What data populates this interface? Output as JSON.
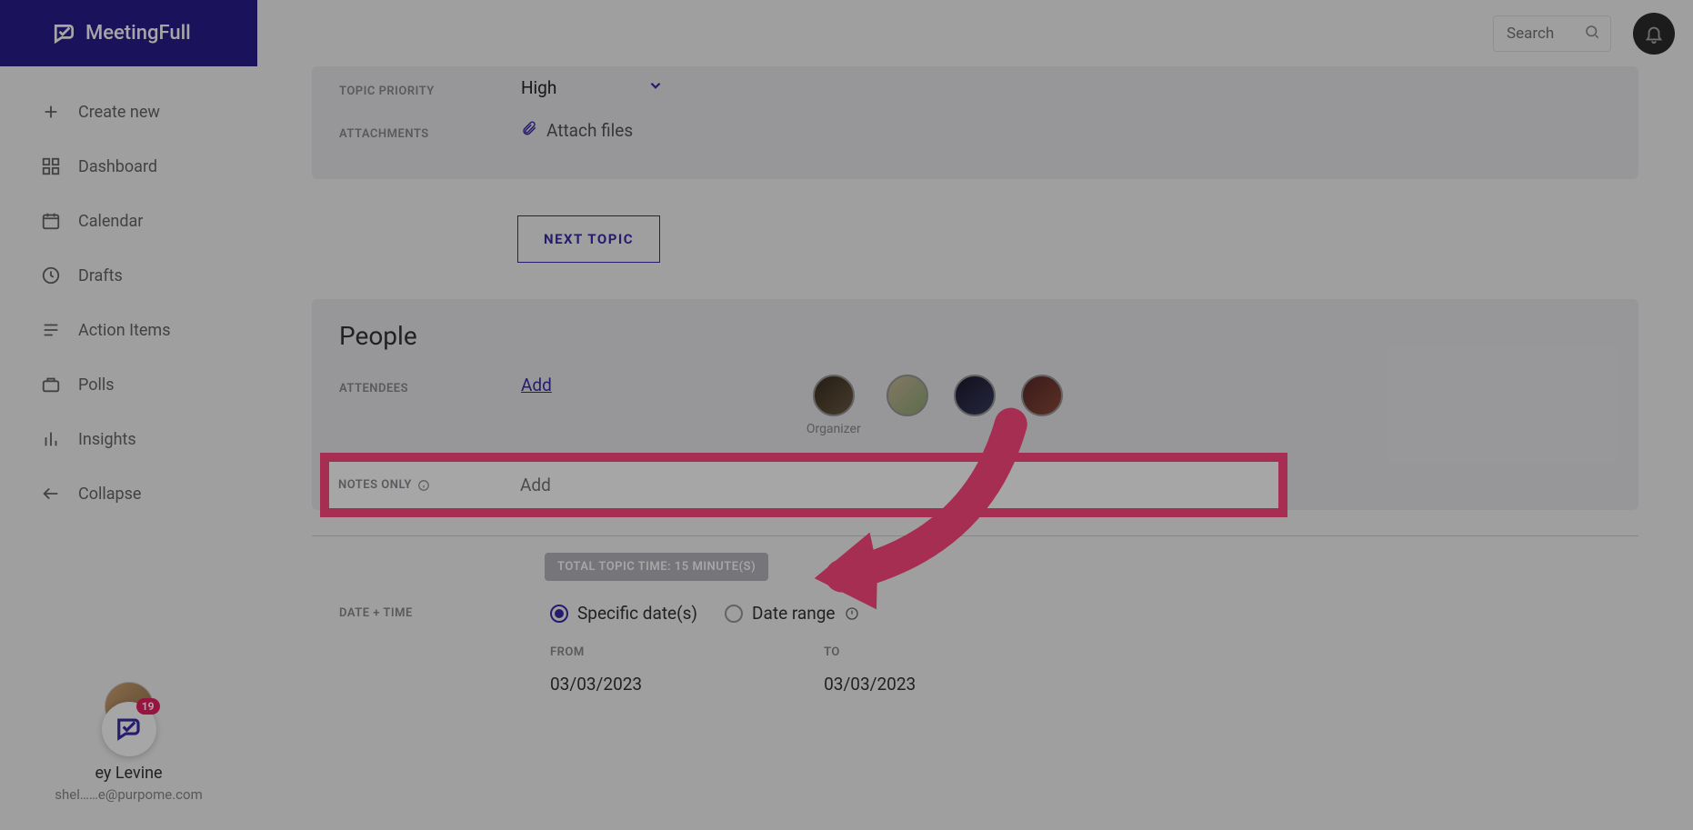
{
  "brand": "MeetingFull",
  "sidebar": {
    "items": [
      {
        "label": "Create new"
      },
      {
        "label": "Dashboard"
      },
      {
        "label": "Calendar"
      },
      {
        "label": "Drafts"
      },
      {
        "label": "Action Items"
      },
      {
        "label": "Polls"
      },
      {
        "label": "Insights"
      },
      {
        "label": "Collapse"
      }
    ]
  },
  "user": {
    "name": "ey Levine",
    "email": "shel……e@purpome.com",
    "badge": "19"
  },
  "search": {
    "placeholder": "Search"
  },
  "topic": {
    "priority_label": "TOPIC PRIORITY",
    "priority_value": "High",
    "attachments_label": "ATTACHMENTS",
    "attach_text": "Attach files",
    "next_topic": "NEXT TOPIC"
  },
  "people": {
    "title": "People",
    "attendees_label": "ATTENDEES",
    "add": "Add",
    "organizer": "Organizer",
    "notes_only_label": "NOTES ONLY",
    "notes_placeholder": "Add"
  },
  "datetime": {
    "total_time": "TOTAL TOPIC TIME: 15 MINUTE(S)",
    "label": "DATE + TIME",
    "specific": "Specific date(s)",
    "range": "Date range",
    "from_label": "FROM",
    "to_label": "TO",
    "from_date": "03/03/2023",
    "to_date": "03/03/2023"
  }
}
